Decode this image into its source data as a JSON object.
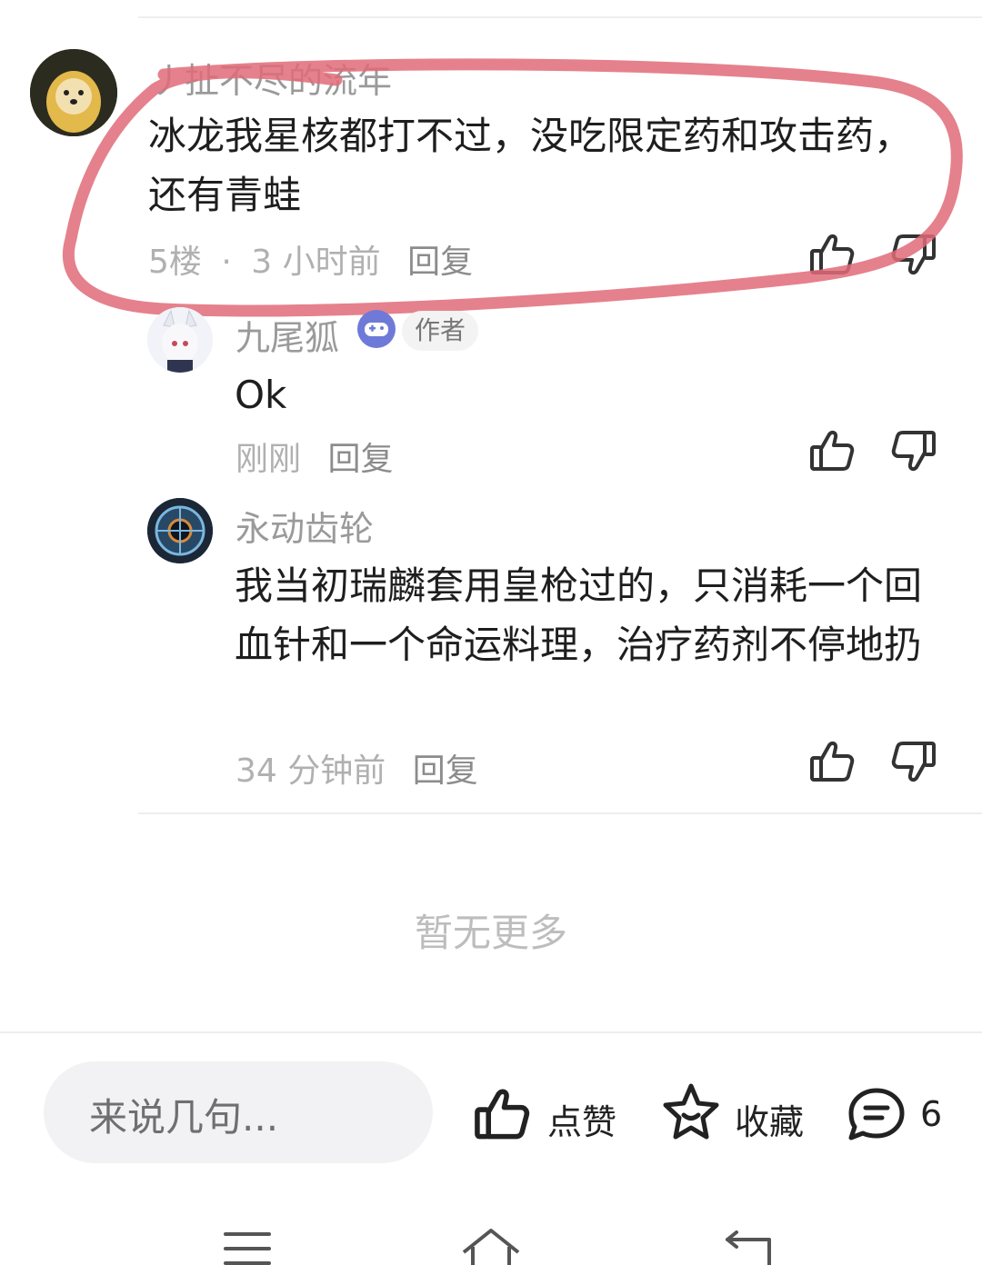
{
  "comments": [
    {
      "username": "丿扯不尽的流年",
      "content": "冰龙我星核都打不过，没吃限定药和攻击药，还有青蛙",
      "floor": "5楼",
      "separator": "·",
      "time": "3 小时前",
      "reply_label": "回复"
    },
    {
      "username": "九尾狐",
      "author_badge": "作者",
      "content": "Ok",
      "time": "刚刚",
      "reply_label": "回复"
    },
    {
      "username": "永动齿轮",
      "content": "我当初瑞麟套用皇枪过的，只消耗一个回血针和一个命运料理，治疗药剂不停地扔",
      "time": "34 分钟前",
      "reply_label": "回复"
    }
  ],
  "footer": {
    "no_more": "暂无更多"
  },
  "bottom_bar": {
    "input_placeholder": "来说几句...",
    "like_label": "点赞",
    "favorite_label": "收藏",
    "comment_count": "6"
  },
  "colors": {
    "annotation_circle": "#e06b78",
    "muted_text": "#b0b0b0",
    "badge_icon": "#6f7ad8"
  },
  "icons": {
    "like": "thumb-up-icon",
    "dislike": "thumb-down-icon",
    "favorite": "star-icon",
    "comment": "chat-bubble-icon",
    "nav_menu": "menu-icon",
    "nav_home": "home-icon",
    "nav_back": "back-icon"
  }
}
